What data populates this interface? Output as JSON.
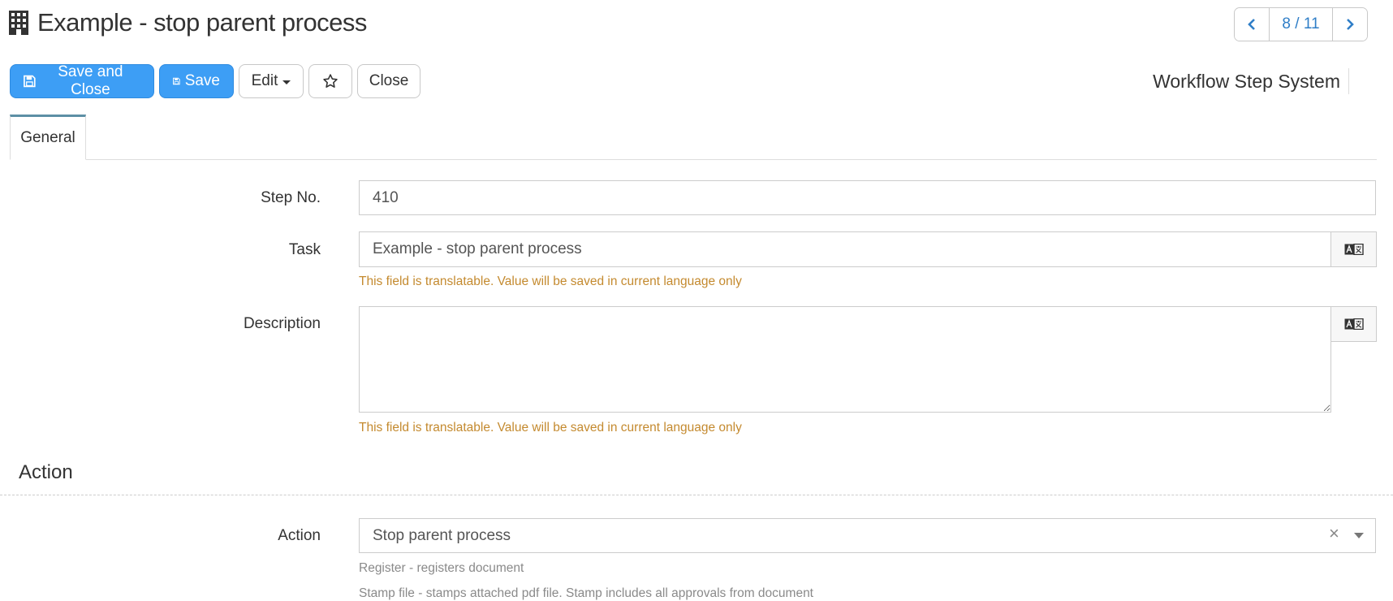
{
  "header": {
    "title": "Example - stop parent process",
    "title_icon": "building-icon",
    "entity_type": "Workflow Step System"
  },
  "pager": {
    "prev_icon": "chevron-left-icon",
    "next_icon": "chevron-right-icon",
    "position": "8 / 11"
  },
  "toolbar": {
    "save_close_label": "Save and Close",
    "save_label": "Save",
    "edit_label": "Edit",
    "favorite_icon": "star-icon",
    "close_label": "Close"
  },
  "tabs": [
    {
      "label": "General",
      "active": true
    }
  ],
  "form": {
    "step_no": {
      "label": "Step No.",
      "value": "410"
    },
    "task": {
      "label": "Task",
      "value": "Example - stop parent process",
      "hint": "This field is translatable. Value will be saved in current language only",
      "addon_icon": "translate-icon"
    },
    "description": {
      "label": "Description",
      "value": "",
      "hint": "This field is translatable. Value will be saved in current language only",
      "addon_icon": "translate-icon"
    }
  },
  "action_section": {
    "title": "Action",
    "action": {
      "label": "Action",
      "value": "Stop parent process",
      "clear_icon": "×",
      "help": [
        "Register - registers document",
        "Stamp file - stamps attached pdf file. Stamp includes all approvals from document"
      ]
    }
  },
  "colors": {
    "primary": "#3d9ef5",
    "link": "#2f7ec7",
    "warning_text": "#c48a2f",
    "tab_accent": "#5d8fa5"
  }
}
